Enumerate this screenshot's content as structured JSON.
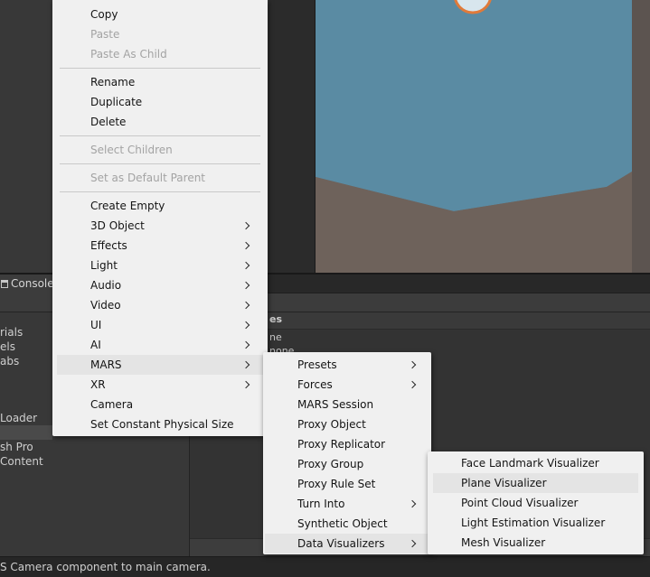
{
  "context_menu": {
    "items": [
      {
        "label": "Copy",
        "disabled": false
      },
      {
        "label": "Paste",
        "disabled": true
      },
      {
        "label": "Paste As Child",
        "disabled": true
      },
      {
        "label": "Rename",
        "disabled": false
      },
      {
        "label": "Duplicate",
        "disabled": false
      },
      {
        "label": "Delete",
        "disabled": false
      },
      {
        "label": "Select Children",
        "disabled": true
      },
      {
        "label": "Set as Default Parent",
        "disabled": true
      },
      {
        "label": "Create Empty",
        "disabled": false
      },
      {
        "label": "3D Object",
        "submenu": true
      },
      {
        "label": "Effects",
        "submenu": true
      },
      {
        "label": "Light",
        "submenu": true
      },
      {
        "label": "Audio",
        "submenu": true
      },
      {
        "label": "Video",
        "submenu": true
      },
      {
        "label": "UI",
        "submenu": true
      },
      {
        "label": "AI",
        "submenu": true
      },
      {
        "label": "MARS",
        "submenu": true,
        "highlighted": true
      },
      {
        "label": "XR",
        "submenu": true
      },
      {
        "label": "Camera",
        "disabled": false
      },
      {
        "label": "Set Constant Physical Size",
        "disabled": false
      }
    ]
  },
  "mars_submenu": {
    "items": [
      {
        "label": "Presets",
        "submenu": true
      },
      {
        "label": "Forces",
        "submenu": true
      },
      {
        "label": "MARS Session"
      },
      {
        "label": "Proxy Object"
      },
      {
        "label": "Proxy Replicator"
      },
      {
        "label": "Proxy Group"
      },
      {
        "label": "Proxy Rule Set"
      },
      {
        "label": "Turn Into",
        "submenu": true
      },
      {
        "label": "Synthetic Object"
      },
      {
        "label": "Data Visualizers",
        "submenu": true,
        "highlighted": true
      }
    ]
  },
  "visualizers_submenu": {
    "items": [
      {
        "label": "Face Landmark Visualizer"
      },
      {
        "label": "Plane Visualizer",
        "highlighted": true
      },
      {
        "label": "Point Cloud Visualizer"
      },
      {
        "label": "Light Estimation Visualizer"
      },
      {
        "label": "Mesh Visualizer"
      }
    ]
  },
  "console_tab": {
    "label": "Console"
  },
  "project_left": {
    "items": [
      "rials",
      "els",
      "abs",
      "Loader",
      "sh Pro",
      "Content"
    ]
  },
  "project_right": {
    "header": "es",
    "items": [
      "ne",
      "none"
    ]
  },
  "status_bar": {
    "text": "S Camera component to main camera."
  },
  "colors": {
    "menu_bg": "#f0f0f0",
    "menu_hover": "#e4e4e4",
    "disabled_text": "#a3a3a3",
    "scene_sky": "#5a8ba3",
    "scene_ground": "#6e625b",
    "editor_bg": "#383838"
  }
}
